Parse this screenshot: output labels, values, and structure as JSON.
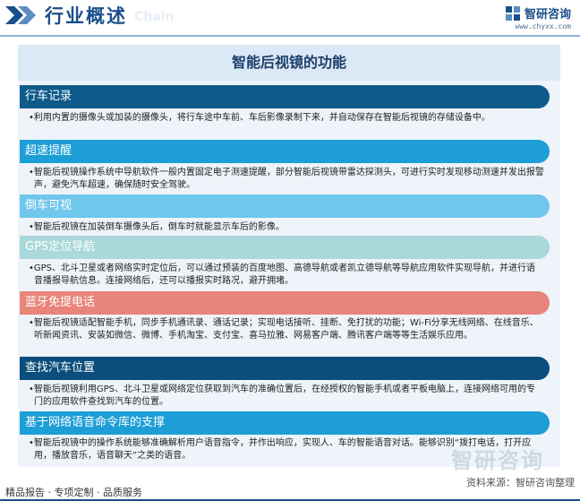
{
  "header": {
    "title": "行业概述",
    "ghost_text": "Chain",
    "brand_name": "智研咨询",
    "site_url": "www.chyxx.com"
  },
  "panel": {
    "title": "智能后视镜的功能"
  },
  "sections": [
    {
      "title": "行车记录",
      "color": "#0e5a8a",
      "text": "利用内置的摄像头或加装的摄像头，将行车途中车前、车后影像录制下来，并自动保存在智能后视镜的存储设备中。"
    },
    {
      "title": "超速提醒",
      "color": "#1d9ed6",
      "text": "智能后视镜操作系统中导航软件一般内置固定电子测速提醒，部分智能后视镜带雷达探测头，可进行实时发现移动测速并发出报警声，避免汽车超速，确保随时安全驾驶。"
    },
    {
      "title": "倒车可视",
      "color": "#6fc7ec",
      "text": "智能后视镜在加装倒车摄像头后，倒车时就能显示车后的影像。"
    },
    {
      "title": "GPS定位导航",
      "color": "#a9d9da",
      "text": "GPS、北斗卫星或者网络实时定位后，可以通过预装的百度地图、高德导航或者凯立德导航等导航应用软件实现导航，并进行语音播报导航信息。连接网络后，还可以播报实时路况，避开拥堵。"
    },
    {
      "title": "蓝牙免提电话",
      "color": "#e8847a",
      "text": "智能后视镜适配智能手机，同步手机通讯录、通话记录；实现电话接听、挂断、免打扰的功能；Wi-Fi分享无线网络、在线音乐、听新闻资讯、安装如微信、微博、手机淘宝、支付宝、喜马拉雅、网易客户端、腾讯客户端等等生活娱乐应用。"
    },
    {
      "title": "查找汽车位置",
      "color": "#0b4d7c",
      "text": "智能后视镜利用GPS、北斗卫星或网络定位获取到汽车的准确位置后，在经授权的智能手机或者平板电脑上，连接网络可用的专门的应用软件查找到汽车的位置。"
    },
    {
      "title": "基于网络语音命令库的支撑",
      "color": "#1d9ed6",
      "text": "智能后视镜中的操作系统能够准确解析用户语音指令，并作出响应，实现人、车的智能语音对话。能够识别“拨打电话，打开应用，播放音乐，语音聊天”之类的语音。"
    }
  ],
  "footer": {
    "left": "精品报告 · 专项定制 · 品质服务",
    "source": "资料来源：智研咨询整理",
    "watermark": "智研咨询"
  }
}
